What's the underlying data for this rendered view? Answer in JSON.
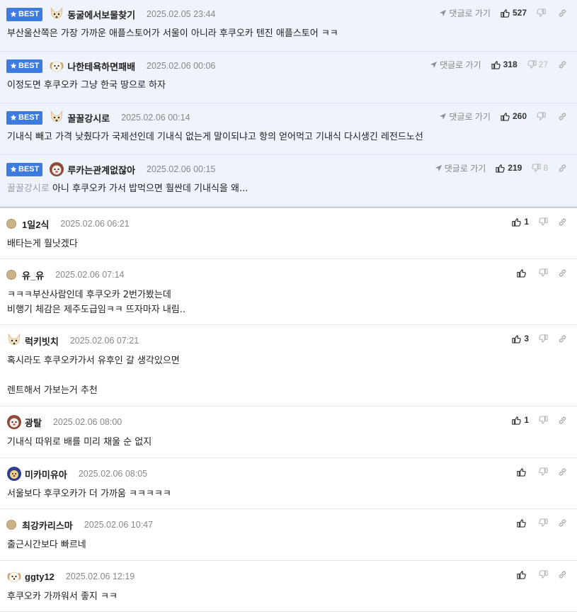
{
  "labels": {
    "best": "BEST",
    "reply_go": "댓글로 가기"
  },
  "best_comments": [
    {
      "nick": "동굴에서보물찾기",
      "date": "2025.02.05 23:44",
      "text": "부산울산쪽은 가장 가까운 애플스토어가 서울이 아니라 후쿠오카 텐진 애플스토어 ㅋㅋ",
      "likes": "527",
      "dislikes": "",
      "avatar": "dog-avatar"
    },
    {
      "nick": "나한테욕하면패배",
      "date": "2025.02.06 00:06",
      "text": "이정도면 후쿠오카 그냥 한국 땅으로 하자",
      "likes": "318",
      "dislikes": "27",
      "avatar": "puppy-avatar"
    },
    {
      "nick": "꿀꿀강시로",
      "date": "2025.02.06 00:14",
      "text": "기내식 빼고 가격 낮췄다가 국제선인데 기내식 없는게 말이되냐고 항의 얻어먹고 기내식 다시생긴 레전드노선",
      "likes": "260",
      "dislikes": "",
      "avatar": "dog-avatar"
    },
    {
      "nick": "루카는관계없잖아",
      "date": "2025.02.06 00:15",
      "ref": "꿀꿀강시로",
      "text": "아니 후쿠오카 가서 밥먹으면 훨싼데 기내식을 왜...",
      "likes": "219",
      "dislikes": "8",
      "avatar": "bear-avatar"
    }
  ],
  "comments": [
    {
      "nick": "1일2식",
      "date": "2025.02.06 06:21",
      "lines": [
        "배타는게 훨낫겠다"
      ],
      "likes": "1",
      "avatar": "dot"
    },
    {
      "nick": "유_유",
      "date": "2025.02.06 07:14",
      "lines": [
        "ㅋㅋㅋ부산사람인데 후쿠오카 2번가봤는데",
        "비행기 체감은 제주도급임ㅋㅋ 뜨자마자 내림.."
      ],
      "likes": "",
      "avatar": "dot"
    },
    {
      "nick": "럭키빗치",
      "date": "2025.02.06 07:21",
      "lines": [
        "혹시라도 후쿠오카가서 유후인 갈 생각있으면",
        "",
        "렌트해서 가보는거 추천"
      ],
      "likes": "3",
      "avatar": "dog-avatar"
    },
    {
      "nick": "광탈",
      "date": "2025.02.06 08:00",
      "lines": [
        "기내식 따위로 배를 미리 채울 순 없지"
      ],
      "likes": "1",
      "avatar": "bear-avatar"
    },
    {
      "nick": "미카미유아",
      "date": "2025.02.06 08:05",
      "lines": [
        "서울보다 후쿠오카가 더 가까움 ㅋㅋㅋㅋㅋ"
      ],
      "likes": "",
      "avatar": "lion-avatar"
    },
    {
      "nick": "최강카리스마",
      "date": "2025.02.06 10:47",
      "lines": [
        "출근시간보다 빠르네"
      ],
      "likes": "",
      "avatar": "dot"
    },
    {
      "nick": "ggty12",
      "date": "2025.02.06 12:19",
      "lines": [
        "후쿠오카 가까워서 좋지 ㅋㅋ"
      ],
      "likes": "",
      "avatar": "puppy-avatar"
    }
  ]
}
